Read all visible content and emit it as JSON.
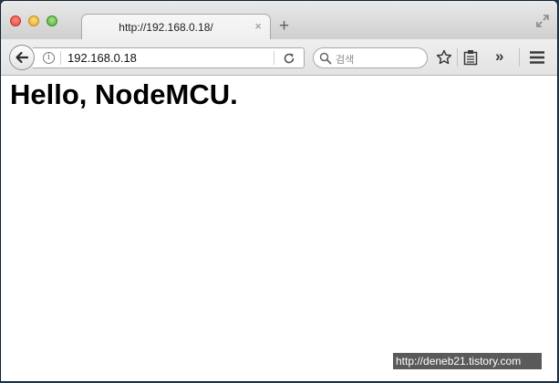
{
  "browser": {
    "tab": {
      "title": "http://192.168.0.18/",
      "close_glyph": "×"
    },
    "new_tab_glyph": "+",
    "url": "192.168.0.18",
    "search": {
      "placeholder": "검색"
    },
    "overflow_glyph": "»"
  },
  "page": {
    "heading": "Hello, NodeMCU."
  },
  "watermark": {
    "text": "http://deneb21.tistory.com"
  },
  "icons": {
    "close": "close-window-icon",
    "minimize": "minimize-window-icon",
    "zoom": "zoom-window-icon",
    "fullscreen": "fullscreen-icon",
    "back": "back-arrow-icon",
    "info": "info-icon",
    "reload": "reload-icon",
    "search": "search-icon",
    "bookmark": "star-icon",
    "reading_list": "clipboard-icon",
    "menu": "hamburger-menu-icon"
  },
  "colors": {
    "traffic_red": "#e0443e",
    "traffic_yellow": "#e0a52a",
    "traffic_green": "#4fa83b",
    "desktop": "#1d3a52"
  }
}
